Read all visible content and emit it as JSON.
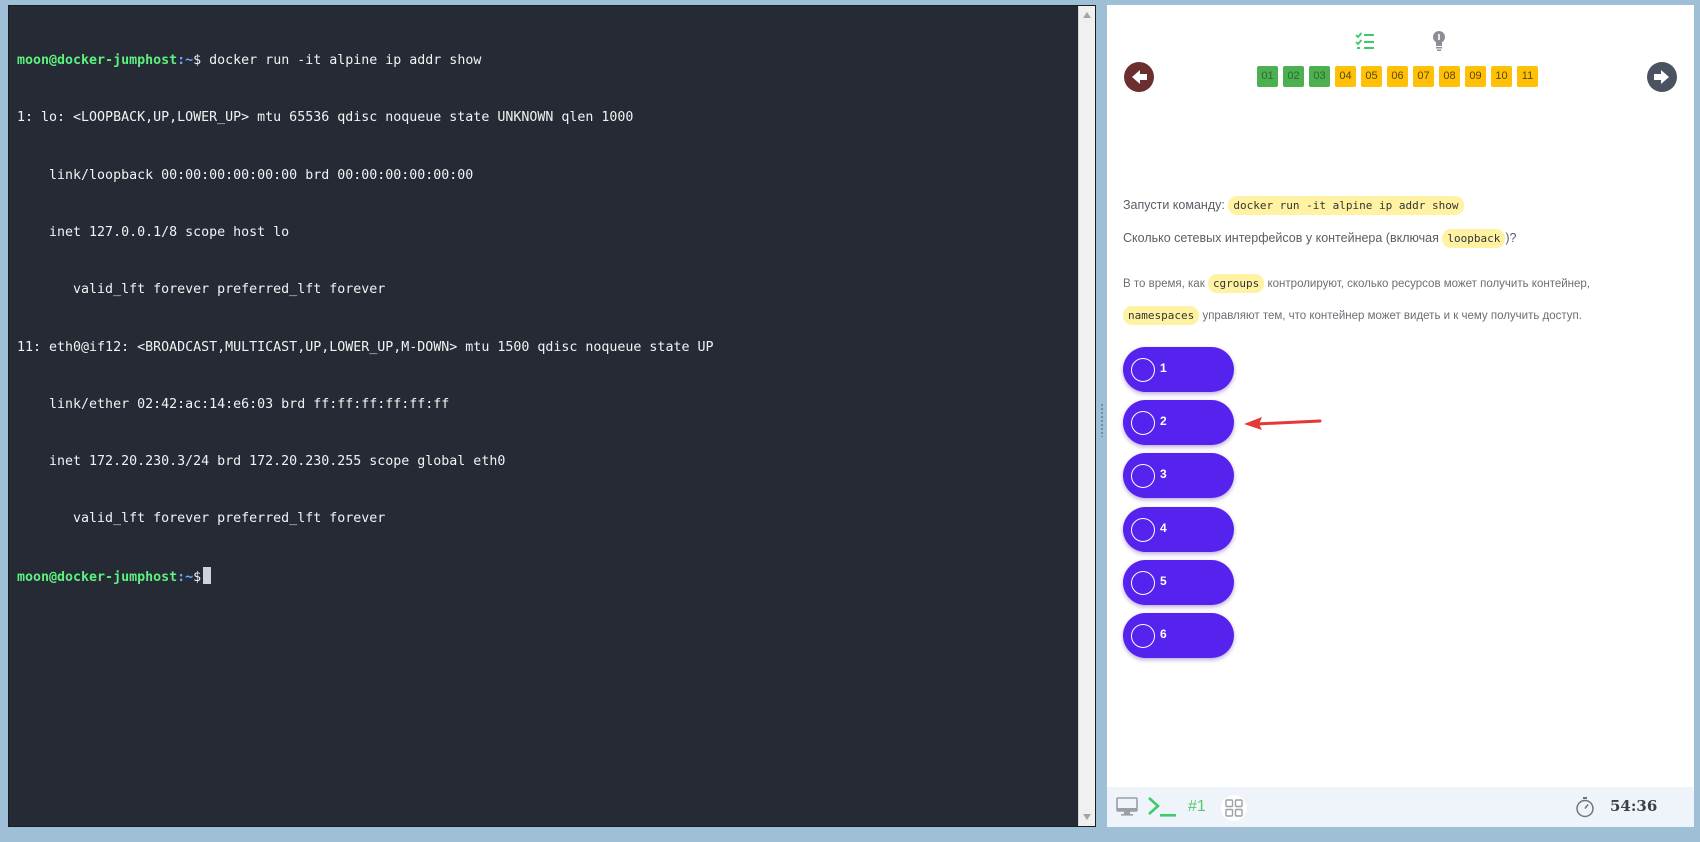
{
  "terminal": {
    "prompt_user": "moon@docker-jumphost",
    "prompt_path": ":~",
    "prompt_symbol": "$",
    "command": " docker run -it alpine ip addr show",
    "output": [
      "1: lo: <LOOPBACK,UP,LOWER_UP> mtu 65536 qdisc noqueue state UNKNOWN qlen 1000",
      "    link/loopback 00:00:00:00:00:00 brd 00:00:00:00:00:00",
      "    inet 127.0.0.1/8 scope host lo",
      "       valid_lft forever preferred_lft forever",
      "11: eth0@if12: <BROADCAST,MULTICAST,UP,LOWER_UP,M-DOWN> mtu 1500 qdisc noqueue state UP",
      "    link/ether 02:42:ac:14:e6:03 brd ff:ff:ff:ff:ff:ff",
      "    inet 172.20.230.3/24 brd 172.20.230.255 scope global eth0",
      "       valid_lft forever preferred_lft forever"
    ]
  },
  "quiz": {
    "tabs": {
      "tasks_icon": "task-list-icon",
      "hint_icon": "lightbulb-icon"
    },
    "prev_icon": "arrow-left-icon",
    "next_icon": "arrow-right-icon",
    "task_numbers": [
      {
        "label": "01",
        "status": "done"
      },
      {
        "label": "02",
        "status": "done"
      },
      {
        "label": "03",
        "status": "done"
      },
      {
        "label": "04",
        "status": "pending"
      },
      {
        "label": "05",
        "status": "pending"
      },
      {
        "label": "06",
        "status": "pending"
      },
      {
        "label": "07",
        "status": "pending"
      },
      {
        "label": "08",
        "status": "pending"
      },
      {
        "label": "09",
        "status": "pending"
      },
      {
        "label": "10",
        "status": "pending"
      },
      {
        "label": "11",
        "status": "pending"
      }
    ],
    "question": {
      "line1_prefix": "Запусти команду:",
      "line1_code": "docker run -it alpine ip addr show",
      "line2_prefix": "Сколько сетевых интерфейсов у контейнера (включая",
      "line2_code": "loopback",
      "line2_suffix": ")?",
      "line3_prefix": "В то время, как",
      "line3_code": "cgroups",
      "line3_suffix": "контролируют, сколько ресурсов может получить контейнер,",
      "line4_code": "namespaces",
      "line4_suffix": "управляют тем, что контейнер может видеть и к чему получить доступ."
    },
    "options": [
      "1",
      "2",
      "3",
      "4",
      "5",
      "6"
    ]
  },
  "bottom_bar": {
    "monitor_icon": "monitor-icon",
    "terminal_icon": "terminal-icon",
    "terminal_number": "#1",
    "grid_icon": "grid-icon",
    "timer_icon": "stopwatch-icon",
    "timer": "54:36"
  },
  "colors": {
    "terminal_bg": "#262a35",
    "prompt_user": "#5cf07e",
    "prompt_path": "#6aa8ff",
    "option_bg": "#5522ee",
    "task_done": "#4caf50",
    "task_pending": "#ffc107",
    "code_highlight": "#fff3a3",
    "annotation_arrow": "#e53935"
  }
}
